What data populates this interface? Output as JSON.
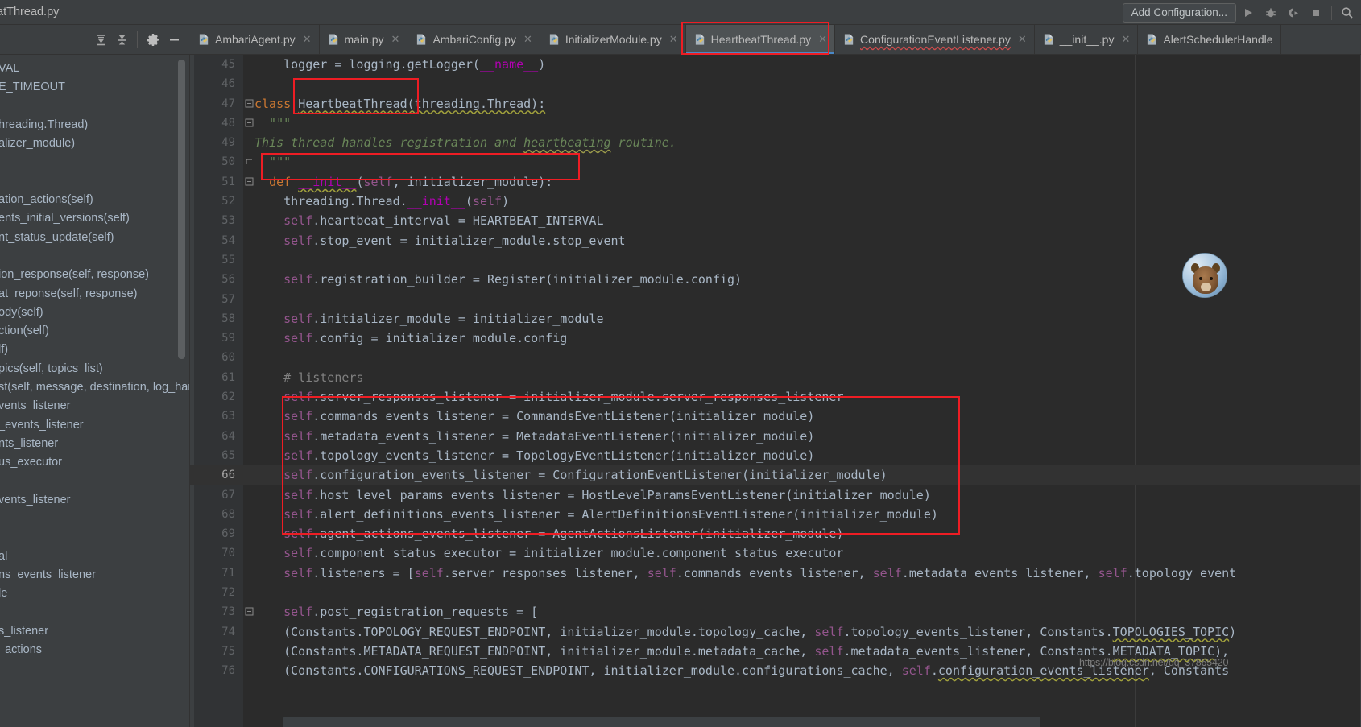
{
  "window": {
    "title_partial": "atThread.py"
  },
  "toolbar": {
    "add_configuration": "Add Configuration...",
    "icons": [
      "run-icon",
      "debug-icon",
      "run-coverage-icon",
      "stop-icon",
      "search-icon"
    ]
  },
  "editor_toolbar": {
    "icons": [
      "expand-all-icon",
      "collapse-all-icon",
      "settings-gear-icon",
      "hide-icon"
    ]
  },
  "tabs": [
    {
      "label": "AmbariAgent.py",
      "active": false,
      "squiggle": false
    },
    {
      "label": "main.py",
      "active": false,
      "squiggle": false
    },
    {
      "label": "AmbariConfig.py",
      "active": false,
      "squiggle": false
    },
    {
      "label": "InitializerModule.py",
      "active": false,
      "squiggle": false
    },
    {
      "label": "HeartbeatThread.py",
      "active": true,
      "squiggle": false
    },
    {
      "label": "ConfigurationEventListener.py",
      "active": false,
      "squiggle": true
    },
    {
      "label": "__init__.py",
      "active": false,
      "squiggle": false
    },
    {
      "label": "AlertSchedulerHandle",
      "active": false,
      "squiggle": false
    }
  ],
  "structure_panel": {
    "items": [
      "VAL",
      "E_TIMEOUT",
      "",
      "hreading.Thread)",
      "alizer_module)",
      "",
      "",
      "ation_actions(self)",
      "ents_initial_versions(self)",
      "nt_status_update(self)",
      "",
      "ion_response(self, response)",
      "at_reponse(self, response)",
      "ody(self)",
      "ction(self)",
      "lf)",
      "pics(self, topics_list)",
      "st(self, message, destination, log_hand",
      "vents_listener",
      "_events_listener",
      "nts_listener",
      "us_executor",
      "",
      "vents_listener",
      "",
      "",
      "al",
      "ns_events_listener",
      "le",
      "",
      "s_listener",
      "_actions"
    ]
  },
  "code": {
    "first_line_number": 45,
    "current_line": 66,
    "lines": [
      {
        "n": 45,
        "indent": 4,
        "text": "logger = logging.getLogger(__name__)"
      },
      {
        "n": 46,
        "indent": 0,
        "text": ""
      },
      {
        "n": 47,
        "indent": 0,
        "text": "class HeartbeatThread(threading.Thread):"
      },
      {
        "n": 48,
        "indent": 2,
        "text": "\"\"\""
      },
      {
        "n": 49,
        "indent": 2,
        "text": "This thread handles registration and heartbeating routine."
      },
      {
        "n": 50,
        "indent": 2,
        "text": "\"\"\""
      },
      {
        "n": 51,
        "indent": 2,
        "text": "def __init__(self, initializer_module):"
      },
      {
        "n": 52,
        "indent": 4,
        "text": "threading.Thread.__init__(self)"
      },
      {
        "n": 53,
        "indent": 4,
        "text": "self.heartbeat_interval = HEARTBEAT_INTERVAL"
      },
      {
        "n": 54,
        "indent": 4,
        "text": "self.stop_event = initializer_module.stop_event"
      },
      {
        "n": 55,
        "indent": 0,
        "text": ""
      },
      {
        "n": 56,
        "indent": 4,
        "text": "self.registration_builder = Register(initializer_module.config)"
      },
      {
        "n": 57,
        "indent": 0,
        "text": ""
      },
      {
        "n": 58,
        "indent": 4,
        "text": "self.initializer_module = initializer_module"
      },
      {
        "n": 59,
        "indent": 4,
        "text": "self.config = initializer_module.config"
      },
      {
        "n": 60,
        "indent": 0,
        "text": ""
      },
      {
        "n": 61,
        "indent": 4,
        "text": "# listeners"
      },
      {
        "n": 62,
        "indent": 4,
        "text": "self.server_responses_listener = initializer_module.server_responses_listener"
      },
      {
        "n": 63,
        "indent": 4,
        "text": "self.commands_events_listener = CommandsEventListener(initializer_module)"
      },
      {
        "n": 64,
        "indent": 4,
        "text": "self.metadata_events_listener = MetadataEventListener(initializer_module)"
      },
      {
        "n": 65,
        "indent": 4,
        "text": "self.topology_events_listener = TopologyEventListener(initializer_module)"
      },
      {
        "n": 66,
        "indent": 4,
        "text": "self.configuration_events_listener = ConfigurationEventListener(initializer_module)"
      },
      {
        "n": 67,
        "indent": 4,
        "text": "self.host_level_params_events_listener = HostLevelParamsEventListener(initializer_module)"
      },
      {
        "n": 68,
        "indent": 4,
        "text": "self.alert_definitions_events_listener = AlertDefinitionsEventListener(initializer_module)"
      },
      {
        "n": 69,
        "indent": 4,
        "text": "self.agent_actions_events_listener = AgentActionsListener(initializer_module)"
      },
      {
        "n": 70,
        "indent": 4,
        "text": "self.component_status_executor = initializer_module.component_status_executor"
      },
      {
        "n": 71,
        "indent": 4,
        "text": "self.listeners = [self.server_responses_listener, self.commands_events_listener, self.metadata_events_listener, self.topology_event"
      },
      {
        "n": 72,
        "indent": 0,
        "text": ""
      },
      {
        "n": 73,
        "indent": 4,
        "text": "self.post_registration_requests = ["
      },
      {
        "n": 74,
        "indent": 4,
        "text": "(Constants.TOPOLOGY_REQUEST_ENDPOINT, initializer_module.topology_cache, self.topology_events_listener, Constants.TOPOLOGIES_TOPIC)"
      },
      {
        "n": 75,
        "indent": 4,
        "text": "(Constants.METADATA_REQUEST_ENDPOINT, initializer_module.metadata_cache, self.metadata_events_listener, Constants.METADATA_TOPIC),"
      },
      {
        "n": 76,
        "indent": 4,
        "text": "(Constants.CONFIGURATIONS_REQUEST_ENDPOINT, initializer_module.configurations_cache, self.configuration_events_listener, Constants"
      }
    ]
  },
  "watermark": {
    "text": "https://blog.csdn.net/qq_37865420"
  },
  "annotations": {
    "highlight_color": "#ee1d24",
    "boxes": [
      {
        "name": "active-tab-highlight"
      },
      {
        "name": "class-name-highlight"
      },
      {
        "name": "init-method-highlight"
      },
      {
        "name": "listeners-block-highlight"
      }
    ]
  },
  "colors": {
    "background": "#2b2b2b",
    "chrome": "#3c3f41",
    "gutter": "#313335",
    "text": "#a9b7c6",
    "keyword": "#cc7832",
    "self": "#94558d",
    "string": "#6a8759",
    "comment": "#808080",
    "accent": "#4a88c7"
  }
}
